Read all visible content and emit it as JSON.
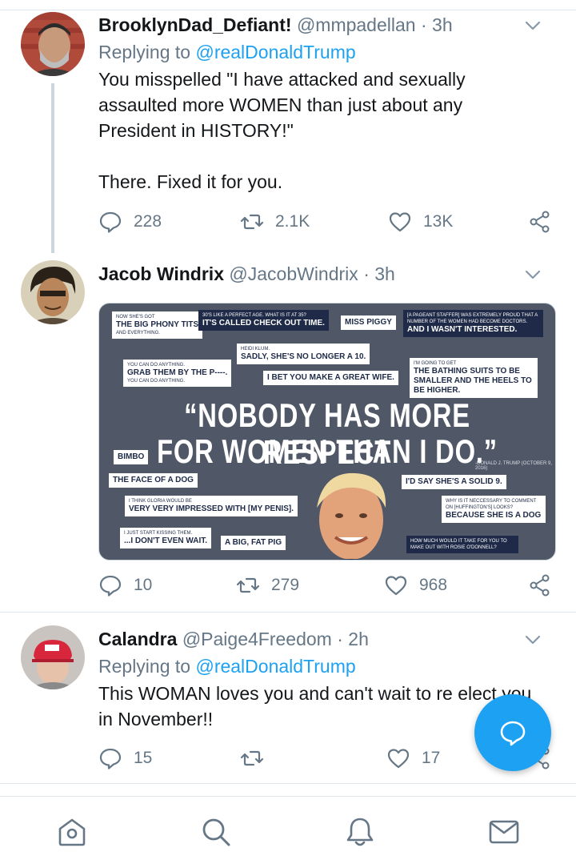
{
  "colors": {
    "accent": "#1da1f2",
    "secondary_text": "#657786",
    "divider": "#e1e8ed"
  },
  "tweets": [
    {
      "name": "BrooklynDad_Defiant!",
      "handle": "@mmpadellan",
      "sep": "·",
      "time": "3h",
      "reply_prefix": "Replying to",
      "reply_to": "@realDonaldTrump",
      "lines": [
        "You misspelled \"I have attacked and sexually",
        "assaulted more WOMEN than just about any",
        "President in HISTORY!\""
      ],
      "extra_line": "There. Fixed it for you.",
      "replies": "228",
      "retweets": "2.1K",
      "likes": "13K"
    },
    {
      "name": "Jacob Windrix",
      "handle": "@JacobWindrix",
      "sep": "·",
      "time": "3h",
      "replies": "10",
      "retweets": "279",
      "likes": "968",
      "image": {
        "quote_line1": "“NOBODY HAS MORE RESPECT",
        "quote_line2": "FOR WOMEN THAN I DO.”",
        "attribution": "-DONALD J. TRUMP (OCTOBER 9, 2016)",
        "cards": [
          {
            "small_top": "NOW SHE'S GOT",
            "main": "THE BIG PHONY TITS",
            "small_bottom": "AND EVERYTHING."
          },
          {
            "small_top": "30'S LIKE A PERFECT AGE. WHAT IS IT AT 35?",
            "main": "IT'S CALLED CHECK OUT TIME."
          },
          {
            "main": "MISS PIGGY"
          },
          {
            "small_top": "[A PAGEANT STAFFER] WAS EXTREMELY PROUD THAT A NUMBER OF THE WOMEN HAD BECOME DOCTORS.",
            "main": "AND I WASN'T INTERESTED."
          },
          {
            "small_top": "HEIDI KLUM.",
            "main": "SADLY, SHE'S NO LONGER A 10."
          },
          {
            "small_top": "YOU CAN DO ANYTHING.",
            "main": "GRAB THEM BY THE P----.",
            "small_bottom": "YOU CAN DO ANYTHING."
          },
          {
            "main": "I BET YOU MAKE A GREAT WIFE."
          },
          {
            "small_top": "I'M GOING TO GET",
            "main": "THE BATHING SUITS TO BE SMALLER AND THE HEELS TO BE HIGHER."
          },
          {
            "main": "BIMBO"
          },
          {
            "main": "THE FACE OF A DOG"
          },
          {
            "main": "I'D SAY SHE'S A SOLID 9."
          },
          {
            "small_top": "I THINK GLORIA WOULD BE",
            "main": "VERY VERY IMPRESSED WITH [MY PENIS]."
          },
          {
            "small_top": "WHY IS IT NECCESSARY TO COMMENT ON [HUFFINGTON'S] LOOKS?",
            "main": "BECAUSE SHE IS A DOG"
          },
          {
            "small_top": "I JUST START KISSING THEM.",
            "main": "...I DON'T EVEN WAIT."
          },
          {
            "main": "A BIG, FAT PIG"
          },
          {
            "small_top": "HOW MUCH WOULD IT TAKE FOR YOU TO MAKE OUT WITH ROSIE O'DONNELL?"
          }
        ]
      }
    },
    {
      "name": "Calandra",
      "handle": "@Paige4Freedom",
      "sep": "·",
      "time": "2h",
      "reply_prefix": "Replying to",
      "reply_to": "@realDonaldTrump",
      "lines": [
        "This WOMAN loves you and can't wait to re elect you",
        "in November!!"
      ],
      "replies": "15",
      "retweets": "",
      "likes": "17"
    }
  ],
  "nav": [
    "home-icon",
    "search-icon",
    "notifications-icon",
    "messages-icon"
  ],
  "fab": "compose-reply-icon"
}
